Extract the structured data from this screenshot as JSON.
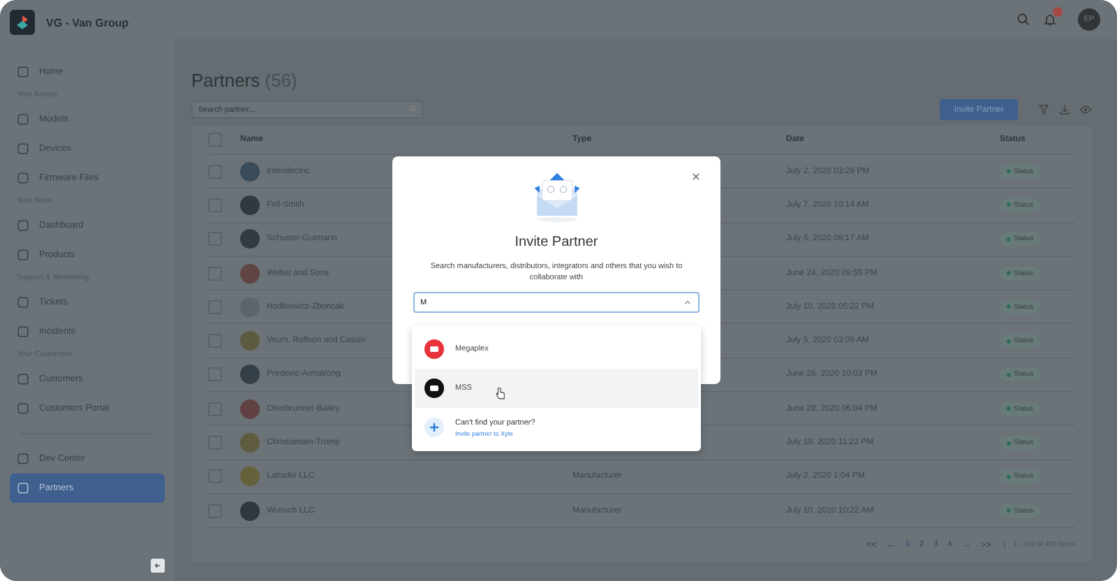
{
  "app": {
    "name": "VG - Van Group",
    "avatar_initials": "EP"
  },
  "sidebar": {
    "sections": [
      {
        "items": [
          {
            "label": "Home",
            "selected": false
          }
        ]
      },
      {
        "title": "Your Assets",
        "items": [
          {
            "label": "Models",
            "selected": false
          },
          {
            "label": "Devices",
            "selected": false
          },
          {
            "label": "Firmware Files",
            "selected": false
          }
        ]
      },
      {
        "title": "Your Store",
        "items": [
          {
            "label": "Dashboard",
            "selected": false
          },
          {
            "label": "Products",
            "selected": false
          }
        ]
      },
      {
        "title": "Support & Monitoring",
        "items": [
          {
            "label": "Tickets",
            "selected": false
          },
          {
            "label": "Incidents",
            "selected": false
          }
        ]
      },
      {
        "title": "Your Customers",
        "items": [
          {
            "label": "Customers",
            "selected": false
          },
          {
            "label": "Customers Portal",
            "selected": false
          }
        ]
      },
      {
        "items": [
          {
            "label": "Dev Center",
            "selected": false
          },
          {
            "label": "Partners",
            "selected": true
          }
        ]
      }
    ]
  },
  "page": {
    "title": "Partners",
    "count": "(56)",
    "search": {
      "placeholder": "Search partner..."
    },
    "invite_button": "Invite Partner"
  },
  "table": {
    "select_all_checked": false,
    "columns": [
      "Name",
      "Type",
      "Date",
      "Status"
    ],
    "rows": [
      {
        "name": "Interelectric",
        "color": "#394b58",
        "date": "July 2, 2020 03:29 PM",
        "status": "Status",
        "checked": false
      },
      {
        "name": "Fell-Smith",
        "color": "#31383e",
        "date": "July 7, 2020 10:14 AM",
        "status": "Status",
        "checked": false
      },
      {
        "name": "Schuster-Gutmann",
        "color": "#323c40",
        "date": "July 5, 2020 09:17 AM",
        "status": "Status",
        "checked": false
      },
      {
        "name": "Weber and Sons",
        "color": "#614544",
        "date": "June 24, 2020 09:55 PM",
        "status": "Status",
        "checked": false
      },
      {
        "name": "Hodkiewicz-Zboncak",
        "color": "#5d656b",
        "date": "July 10, 2020 05:22 PM",
        "status": "Status",
        "checked": false
      },
      {
        "name": "Veum, Rolfson and Cassin",
        "color": "#5d5b3f",
        "date": "July 5, 2020 03:09 AM",
        "status": "Status",
        "checked": false
      },
      {
        "name": "Predovic-Armstrong",
        "color": "#353f48",
        "date": "June 26, 2020 10:03 PM",
        "status": "Status",
        "checked": false
      },
      {
        "name": "Oberbrunner-Bailey",
        "color": "#614144",
        "date": "June 28, 2020 06:04 PM",
        "status": "Status",
        "checked": false
      },
      {
        "name": "Christiansen-Tromp",
        "color": "#5f5b3f",
        "date": "July 19, 2020 11:22 PM",
        "status": "Status",
        "checked": false
      },
      {
        "name": "Labadie LLC",
        "color": "#65613b",
        "type": "Manufacturer",
        "date": "July 2, 2020 1:04 PM",
        "status": "Status",
        "checked": false
      },
      {
        "name": "Wunsch LLC",
        "color": "#30383e",
        "type": "Manufacturer",
        "date": "July 10, 2020 10:22 AM",
        "status": "Status",
        "checked": false
      }
    ]
  },
  "pagination": {
    "first": "<<",
    "prev": "←",
    "pages": [
      {
        "label": "1",
        "selected": true
      },
      {
        "label": "2",
        "selected": false
      },
      {
        "label": "3",
        "selected": false
      },
      {
        "label": "4",
        "selected": false
      }
    ],
    "next": "→",
    "last": ">>",
    "summary": "1 - 100 of 400 items"
  },
  "modal": {
    "title": "Invite Partner",
    "description": "Search manufacturers, distributors, integrators and others that you wish to collaborate with",
    "search_value": "M",
    "options": [
      {
        "name": "Megaplex",
        "color": "#e8323c",
        "highlighted": false
      },
      {
        "name": "MSS",
        "color": "#111111",
        "highlighted": true
      }
    ],
    "not_found": {
      "title": "Can't find your partner?",
      "link": "Invite partner to Xyte"
    }
  }
}
